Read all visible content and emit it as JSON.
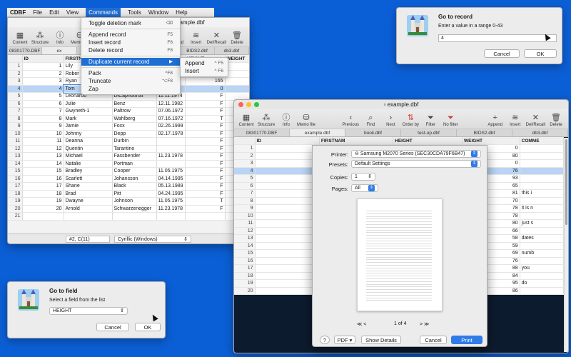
{
  "menubar": {
    "app": "CDBF",
    "items": [
      "File",
      "Edit",
      "View",
      "Commands",
      "Tools",
      "Window",
      "Help"
    ],
    "active": "Commands"
  },
  "commands_menu": {
    "items": [
      {
        "label": "Toggle deletion mark",
        "shortcut": "⌫"
      },
      {
        "sep": true
      },
      {
        "label": "Append record",
        "shortcut": "F5"
      },
      {
        "label": "Insert record",
        "shortcut": "F6"
      },
      {
        "label": "Delete record",
        "shortcut": "F8"
      },
      {
        "sep": true
      },
      {
        "label": "Duplicate current record",
        "shortcut": "▶",
        "active": true
      },
      {
        "sep": true
      },
      {
        "label": "Pack",
        "shortcut": "^F8"
      },
      {
        "label": "Truncate",
        "shortcut": "⌥F8"
      },
      {
        "label": "Zap",
        "shortcut": ""
      }
    ],
    "submenu": [
      {
        "label": "Append",
        "shortcut": "^ F5"
      },
      {
        "label": "Insert",
        "shortcut": "^ F6"
      }
    ]
  },
  "window1": {
    "title": "example.dbf",
    "toolbar_left": [
      {
        "label": "Content",
        "icon": "grid-icon"
      },
      {
        "label": "Structure",
        "icon": "structure-icon"
      },
      {
        "label": "Info",
        "icon": "info-icon"
      },
      {
        "label": "Memo file",
        "icon": "database-icon"
      }
    ],
    "toolbar_right": [
      {
        "label": "No order",
        "icon": "sort-icon"
      },
      {
        "label": "Filter",
        "icon": "filter-icon"
      },
      {
        "label": "No filter",
        "icon": "no-filter-icon"
      },
      {
        "label": "Append",
        "icon": "plus-icon"
      },
      {
        "label": "Insert",
        "icon": "insert-icon"
      },
      {
        "label": "Del/Recall",
        "icon": "x-icon"
      },
      {
        "label": "Delete",
        "icon": "trash-icon"
      }
    ],
    "tabs": [
      "08301770.DBF",
      "ex",
      "",
      "",
      "test-up.dbf",
      "BIDS2.dbf",
      "db3.dbf"
    ],
    "columns": [
      "",
      "ID",
      "FIRSTN",
      "",
      "",
      "HEIGHT",
      "WEIGHT",
      "COMME"
    ],
    "rows": [
      [
        "1",
        "1",
        "Lily",
        "",
        "",
        "180",
        "0",
        ""
      ],
      [
        "2",
        "2",
        "Rober",
        "4.1995",
        "",
        "0",
        "80",
        ""
      ],
      [
        "3",
        "3",
        "Ryan",
        "4.1995",
        "F",
        "165",
        "0",
        ""
      ],
      [
        "4",
        "4",
        "Tom",
        "1.1982",
        "F",
        "0",
        "76",
        ""
      ],
      [
        "5",
        "5",
        "Leonardo",
        "DiCapriottrutt",
        "11.11.1974",
        "F",
        "",
        ""
      ],
      [
        "6",
        "6",
        "Julie",
        "Benz",
        "12.11.1982",
        "F",
        "",
        ""
      ],
      [
        "7",
        "7",
        "Gwyneth-1",
        "Paltrow",
        "07.06.1972",
        "F",
        "",
        ""
      ],
      [
        "8",
        "8",
        "Mark",
        "Wahlberg",
        "07.16.1972",
        "T",
        "",
        ""
      ],
      [
        "9",
        "9",
        "Jamie",
        "Foxx",
        "02.26.1999",
        "F",
        "",
        ""
      ],
      [
        "10",
        "10",
        "Johnny",
        "Depp",
        "02.17.1978",
        "F",
        "",
        ""
      ],
      [
        "11",
        "11",
        "Deanna",
        "Durbin",
        "",
        "F",
        "",
        ""
      ],
      [
        "12",
        "12",
        "Quentin",
        "Tarantino",
        "",
        "F",
        "",
        ""
      ],
      [
        "13",
        "13",
        "Michael",
        "Fassbender",
        "11.23.1978",
        "F",
        "",
        ""
      ],
      [
        "14",
        "14",
        "Natalie",
        "Portman",
        "",
        "F",
        "",
        ""
      ],
      [
        "15",
        "15",
        "Bradley",
        "Cooper",
        "11.05.1975",
        "F",
        "",
        ""
      ],
      [
        "16",
        "16",
        "Scarlett",
        "Johansson",
        "04.14.1995",
        "F",
        "",
        ""
      ],
      [
        "17",
        "17",
        "Shane",
        "Black",
        "05.13.1989",
        "F",
        "",
        ""
      ],
      [
        "18",
        "18",
        "Brad",
        "Pitt",
        "04.24.1995",
        "F",
        "",
        ""
      ],
      [
        "19",
        "19",
        "Dwayne",
        "Johnson",
        "11.05.1975",
        "T",
        "",
        ""
      ],
      [
        "20",
        "20",
        "Arnold",
        "Schwarzenegger",
        "11.23.1978",
        "F",
        "",
        ""
      ],
      [
        "21",
        "",
        "",
        "",
        "",
        "",
        "",
        ""
      ]
    ],
    "status_field": "#2, C(11)",
    "encoding": "Cyrillic (Windows)"
  },
  "window2": {
    "title": "example.dbf",
    "toolbar_left": [
      {
        "label": "Content",
        "icon": "grid-icon"
      },
      {
        "label": "Structure",
        "icon": "structure-icon"
      },
      {
        "label": "Info",
        "icon": "info-icon"
      },
      {
        "label": "Memo file",
        "icon": "database-icon"
      }
    ],
    "toolbar_mid": [
      {
        "label": "Previous",
        "icon": "arrow-left-icon"
      },
      {
        "label": "Find",
        "icon": "search-icon"
      },
      {
        "label": "Next",
        "icon": "arrow-right-icon"
      },
      {
        "label": "Order by",
        "icon": "sort-icon"
      },
      {
        "label": "Filter",
        "icon": "filter-icon"
      },
      {
        "label": "No filter",
        "icon": "no-filter-icon"
      }
    ],
    "toolbar_right": [
      {
        "label": "Append",
        "icon": "plus-icon"
      },
      {
        "label": "Insert",
        "icon": "insert-icon"
      },
      {
        "label": "Del/Recall",
        "icon": "x-icon"
      },
      {
        "label": "Delete",
        "icon": "trash-icon"
      }
    ],
    "tabs": [
      "08301770.DBF",
      "example.dbf",
      "book.dbf",
      "test-up.dbf",
      "BIDS2.dbf",
      "db3.dbf"
    ],
    "columns": [
      "",
      "ID",
      "FIRSTNAM",
      "HEIGHT",
      "WEIGHT",
      "COMME"
    ],
    "rows": [
      [
        "1",
        "1",
        "Lily",
        "180",
        "0",
        ""
      ],
      [
        "2",
        "2",
        "Robert",
        "0",
        "80",
        ""
      ],
      [
        "3",
        "3",
        "Ryan",
        "165",
        "0",
        ""
      ],
      [
        "4",
        "4",
        "Tom",
        "0",
        "76",
        ""
      ],
      [
        "5",
        "5",
        "Leonardo",
        "190",
        "93",
        ""
      ],
      [
        "6",
        "6",
        "Julie",
        "0",
        "65",
        ""
      ],
      [
        "7",
        "7",
        "Gwyneth-",
        "178",
        "81",
        "this i"
      ],
      [
        "8",
        "8",
        "Mark",
        "0",
        "70",
        ""
      ],
      [
        "9",
        "9",
        "Jamie",
        "175",
        "78",
        "it is n"
      ],
      [
        "10",
        "10",
        "Johnny",
        "175",
        "78",
        ""
      ],
      [
        "11",
        "11",
        "Deanna",
        "177",
        "80",
        "just s"
      ],
      [
        "12",
        "12",
        "Quentin",
        "55",
        "66",
        ""
      ],
      [
        "13",
        "13",
        "Michael",
        "175",
        "58",
        "dates"
      ],
      [
        "14",
        "14",
        "Natalie",
        "156",
        "59",
        ""
      ],
      [
        "15",
        "15",
        "Bradley",
        "0",
        "69",
        "numb"
      ],
      [
        "16",
        "16",
        "Scarlett",
        "173",
        "76",
        ""
      ],
      [
        "17",
        "17",
        "Shane",
        "185",
        "88",
        "you"
      ],
      [
        "18",
        "18",
        "Brad",
        "0",
        "84",
        ""
      ],
      [
        "19",
        "19",
        "Dwayne",
        "192",
        "95",
        "do"
      ],
      [
        "20",
        "20",
        "Arnold",
        "0",
        "86",
        ""
      ]
    ]
  },
  "print_sheet": {
    "printer_label": "Printer:",
    "printer_value": "Samsung M2070 Series (SEC30CDA79F6B47)",
    "presets_label": "Presets:",
    "presets_value": "Default Settings",
    "copies_label": "Copies:",
    "copies_value": "1",
    "pages_label": "Pages:",
    "pages_value": "All",
    "page_indicator": "1 of 4",
    "help": "?",
    "pdf": "PDF",
    "show_details": "Show Details",
    "cancel": "Cancel",
    "print": "Print"
  },
  "go_to_record": {
    "title": "Go to record",
    "prompt": "Enter a value in a range 0-43",
    "value": "4",
    "cancel": "Cancel",
    "ok": "OK"
  },
  "go_to_field": {
    "title": "Go to field",
    "prompt": "Select a field from the list",
    "value": "HEIGHT",
    "cancel": "Cancel",
    "ok": "OK"
  },
  "colors": {
    "desktop": "#0b5fd6",
    "menu_highlight": "#1f6ed4",
    "print_button": "#2f7be8"
  }
}
